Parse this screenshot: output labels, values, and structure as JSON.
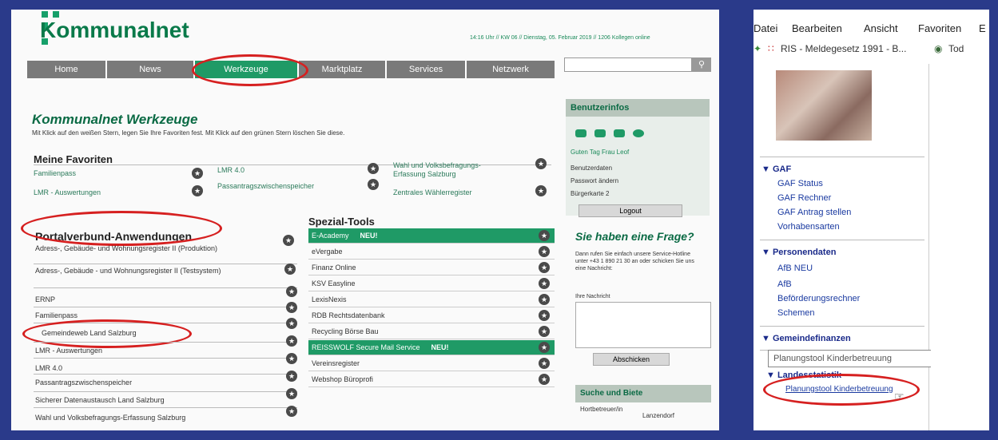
{
  "left": {
    "brand": "Kommunalnet",
    "status_line": "14:16 Uhr  //  KW 06  //  Dienstag, 05. Februar 2019  //  1206 Kollegen online",
    "nav": [
      "Home",
      "News",
      "Werkzeuge",
      "Marktplatz",
      "Services",
      "Netzwerk"
    ],
    "active_nav": "Werkzeuge",
    "page_title": "Kommunalnet Werkzeuge",
    "page_desc": "Mit Klick auf den weißen Stern, legen Sie Ihre Favoriten fest. Mit Klick auf den grünen Stern löschen Sie diese.",
    "favorites_head": "Meine Favoriten",
    "favorites": [
      "Familienpass",
      "LMR - Auswertungen",
      "LMR 4.0",
      "Passantragszwischenspeicher",
      "Wahl und Volksbefragungs-Erfassung Salzburg",
      "Zentrales Wählerregister"
    ],
    "portal_head": "Portalverbund-Anwendungen",
    "portal": [
      "Adress-, Gebäude- und Wohnungsregister II (Produktion)",
      "Adress-, Gebäude - und Wohnungsregister II (Testsystem)",
      "ERNP",
      "Familienpass",
      "Gemeindeweb Land Salzburg",
      "LMR - Auswertungen",
      "LMR 4.0",
      "Passantragszwischenspeicher",
      "Sicherer Datenaustausch Land Salzburg",
      "Wahl und Volksbefragungs-Erfassung Salzburg"
    ],
    "spezial_head": "Spezial-Tools",
    "spezial": [
      {
        "label": "E-Academy",
        "badge": "NEU!",
        "green": true
      },
      {
        "label": "eVergabe",
        "badge": "",
        "green": false
      },
      {
        "label": "Finanz Online",
        "badge": "",
        "green": false
      },
      {
        "label": "KSV Easyline",
        "badge": "",
        "green": false
      },
      {
        "label": "LexisNexis",
        "badge": "",
        "green": false
      },
      {
        "label": "RDB Rechtsdatenbank",
        "badge": "",
        "green": false
      },
      {
        "label": "Recycling Börse Bau",
        "badge": "",
        "green": false
      },
      {
        "label": "REISSWOLF Secure Mail Service",
        "badge": "NEU!",
        "green": true
      },
      {
        "label": "Vereinsregister",
        "badge": "",
        "green": false
      },
      {
        "label": "Webshop Büroprofi",
        "badge": "",
        "green": false
      }
    ],
    "userinfo": {
      "head": "Benutzerinfos",
      "greeting": "Guten Tag Frau Leof",
      "links": [
        "Benutzerdaten",
        "Passwort ändern",
        "Bürgerkarte 2"
      ],
      "logout": "Logout"
    },
    "frage": {
      "title": "Sie haben eine Frage?",
      "text": "Dann rufen Sie einfach unsere Service-Hotline unter +43 1 890 21 30 an oder schicken Sie uns eine Nachricht:",
      "label": "Ihre Nachricht",
      "button": "Abschicken"
    },
    "suche": {
      "head": "Suche und Biete",
      "item": "Hortbetreuer/in",
      "place": "Lanzendorf"
    }
  },
  "right": {
    "menu": [
      "Datei",
      "Bearbeiten",
      "Ansicht",
      "Favoriten",
      "E"
    ],
    "tab1": "RIS - Meldegesetz 1991 - B...",
    "tab2": "Tod",
    "gaf_head": "GAF",
    "gaf_items": [
      "GAF Status",
      "GAF Rechner",
      "GAF Antrag stellen",
      "Vorhabensarten"
    ],
    "person_head": "Personendaten",
    "person_items": [
      "AfB NEU",
      "AfB",
      "Beförderungsrechner",
      "Schemen"
    ],
    "finanz_head": "Gemeindefinanzen",
    "tooltip": "Planungstool Kinderbetreuung",
    "stat_head": "Landesstatistik",
    "stat_link": "Planungstool Kinderbetreuung"
  }
}
